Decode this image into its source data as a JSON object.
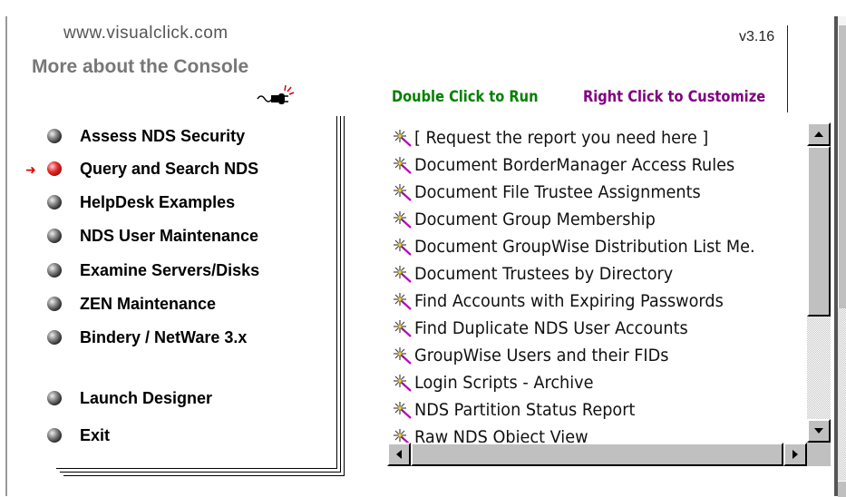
{
  "header": {
    "site_link": "www.visualclick.com",
    "more_link": "More about the Console",
    "version": "v3.16",
    "hint_run": "Double Click to Run",
    "hint_customize": "Right Click to Customize"
  },
  "menu": {
    "active_index": 1,
    "items": [
      {
        "label": "Assess NDS Security"
      },
      {
        "label": "Query and Search NDS"
      },
      {
        "label": "HelpDesk Examples"
      },
      {
        "label": "NDS User Maintenance"
      },
      {
        "label": "Examine Servers/Disks"
      },
      {
        "label": "ZEN Maintenance"
      },
      {
        "label": "Bindery / NetWare 3.x"
      },
      {
        "label": "Launch Designer"
      },
      {
        "label": "Exit"
      }
    ]
  },
  "report_list": {
    "item_icon": "sparkle-wand-icon",
    "items": [
      "[ Request the report you need here ]",
      "Document BorderManager Access Rules",
      "Document File Trustee Assignments",
      "Document Group Membership",
      "Document GroupWise Distribution List Me.",
      "Document Trustees by Directory",
      "Find Accounts with Expiring Passwords",
      "Find Duplicate NDS User Accounts",
      "GroupWise Users and their FIDs",
      "Login Scripts - Archive",
      "NDS Partition Status Report",
      "Raw NDS Object View"
    ]
  },
  "colors": {
    "hint_run": "#008000",
    "hint_customize": "#800080",
    "active_arrow": "#e00000",
    "header_gray": "#777777"
  }
}
